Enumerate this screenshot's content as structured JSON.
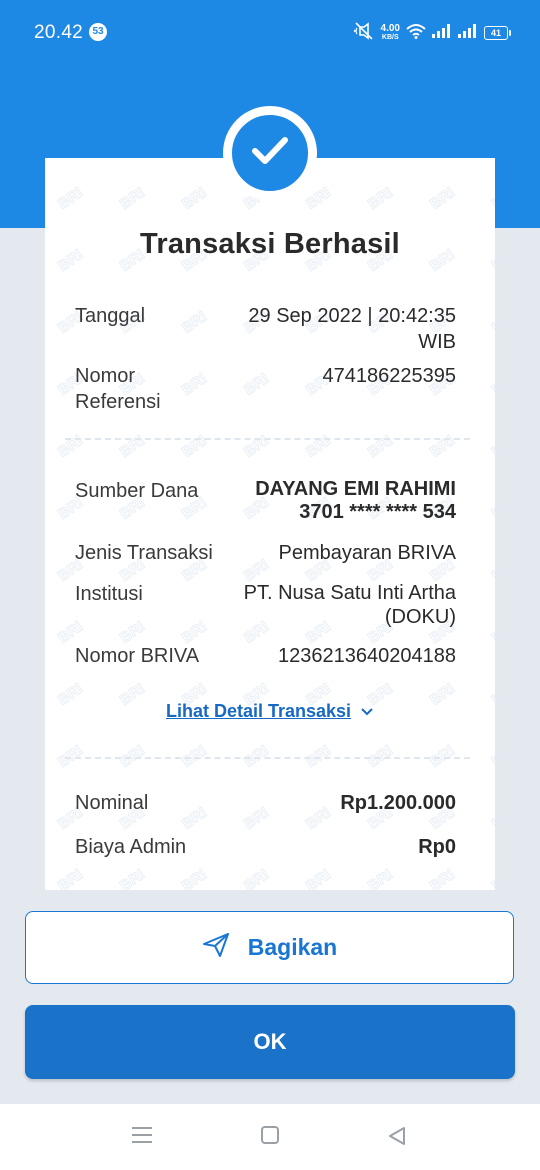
{
  "status_bar": {
    "time": "20.42",
    "notification_count": "53",
    "net_speed": "4.00",
    "net_speed_unit": "KB/S",
    "battery": "41"
  },
  "receipt": {
    "title": "Transaksi Berhasil",
    "tanggal_label": "Tanggal",
    "tanggal_line1": "29 Sep 2022 | 20:42:35",
    "tanggal_line2": "WIB",
    "ref_label_line1": "Nomor",
    "ref_label_line2": "Referensi",
    "ref_value": "474186225395",
    "sumber_label": "Sumber Dana",
    "sumber_name": "DAYANG EMI RAHIMI",
    "sumber_account": "3701 **** **** 534",
    "jenis_label": "Jenis Transaksi",
    "jenis_value": "Pembayaran BRIVA",
    "institusi_label": "Institusi",
    "institusi_line1": "PT. Nusa Satu Inti Artha",
    "institusi_line2": "(DOKU)",
    "briva_label": "Nomor BRIVA",
    "briva_value": "1236213640204188",
    "detail_link": "Lihat Detail Transaksi",
    "nominal_label": "Nominal",
    "nominal_value": "Rp1.200.000",
    "admin_label": "Biaya Admin",
    "admin_value": "Rp0"
  },
  "actions": {
    "share_label": "Bagikan",
    "ok_label": "OK"
  },
  "icons": {
    "success": "check-icon",
    "share": "send-icon",
    "expand": "chevron-down-icon"
  },
  "colors": {
    "primary": "#1e88e5",
    "button": "#1a73c8",
    "link": "#1769c4"
  }
}
